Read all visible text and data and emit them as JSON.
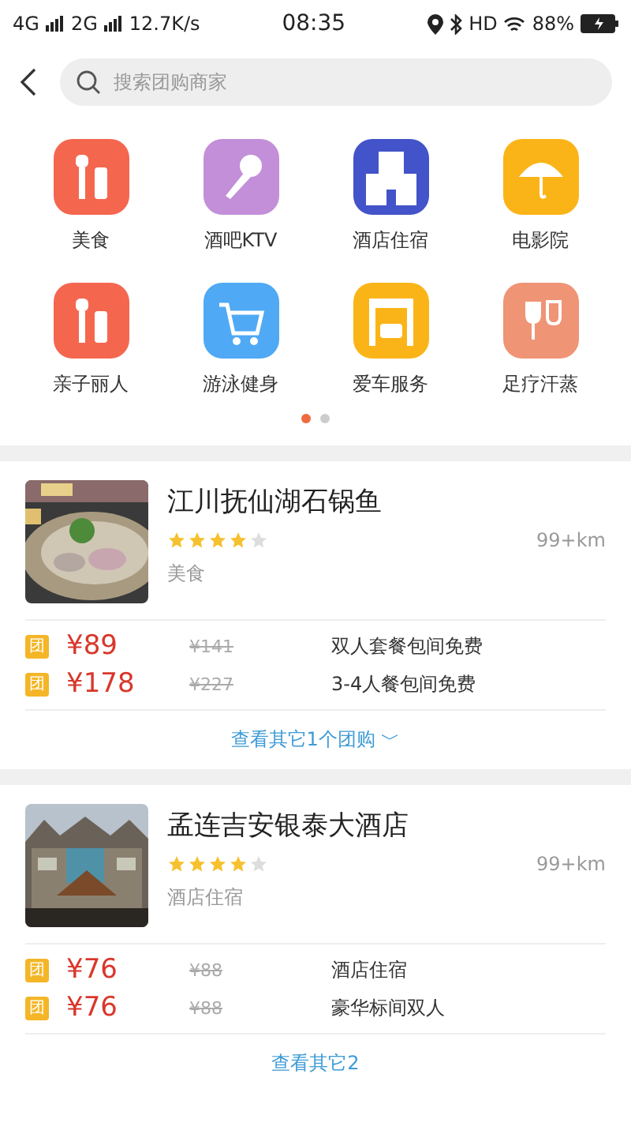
{
  "status_bar": {
    "network_1": "4G",
    "network_2": "2G",
    "speed": "12.7K/s",
    "time": "08:35",
    "hd": "HD",
    "battery": "88%"
  },
  "search": {
    "placeholder": "搜索团购商家"
  },
  "categories": [
    {
      "label": "美食",
      "color": "#f5664f"
    },
    {
      "label": "酒吧KTV",
      "color": "#c38fd8"
    },
    {
      "label": "酒店住宿",
      "color": "#4353c9"
    },
    {
      "label": "电影院",
      "color": "#fbb418"
    },
    {
      "label": "亲子丽人",
      "color": "#f5664f"
    },
    {
      "label": "游泳健身",
      "color": "#4fa9f5"
    },
    {
      "label": "爱车服务",
      "color": "#fbb418"
    },
    {
      "label": "足疗汗蒸",
      "color": "#ef9475"
    }
  ],
  "pager": [
    {
      "selected": true
    },
    {
      "selected": false
    }
  ],
  "shops": [
    {
      "name": "江川抚仙湖石锅鱼",
      "stars": 4,
      "distance": "99+km",
      "category": "美食",
      "deals": [
        {
          "badge": "团",
          "price": "¥89",
          "original": "¥141",
          "title": "双人套餐包间免费"
        },
        {
          "badge": "团",
          "price": "¥178",
          "original": "¥227",
          "title": "3-4人餐包间免费"
        }
      ],
      "more": "查看其它1个团购 ﹀"
    },
    {
      "name": "孟连吉安银泰大酒店",
      "stars": 4,
      "distance": "99+km",
      "category": "酒店住宿",
      "deals": [
        {
          "badge": "团",
          "price": "¥76",
          "original": "¥88",
          "title": "酒店住宿"
        },
        {
          "badge": "团",
          "price": "¥76",
          "original": "¥88",
          "title": "豪华标间双人"
        }
      ],
      "more": "查看其它2"
    }
  ]
}
